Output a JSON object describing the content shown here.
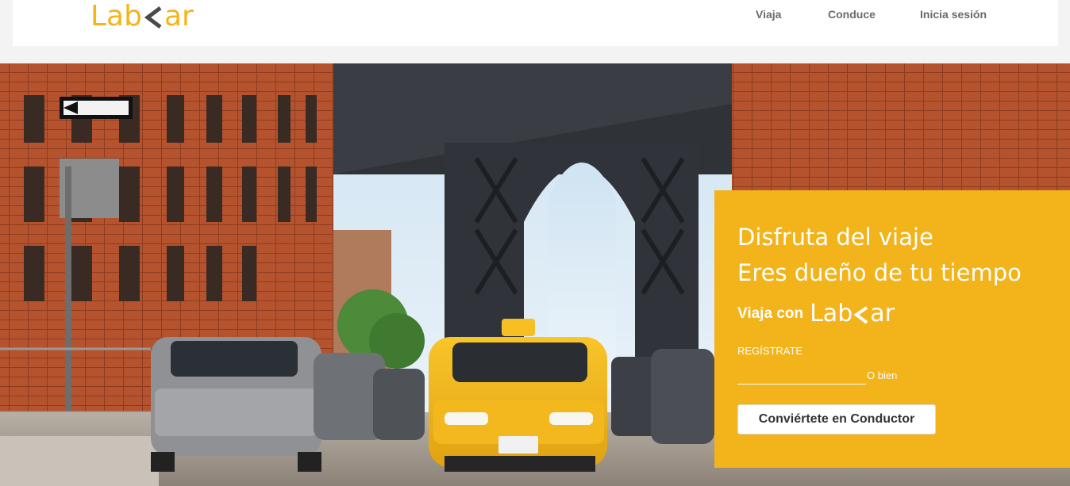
{
  "brand": {
    "name_left": "Lab",
    "name_right": "ar",
    "color": "#f4b51a"
  },
  "nav": {
    "items": [
      "Viaja",
      "Conduce",
      "Inicia sesión"
    ]
  },
  "hero": {
    "image": "city-street-taxi-bridge-photo"
  },
  "panel": {
    "background": "#f3b31b",
    "tagline_1": "Disfruta del viaje",
    "tagline_2": "Eres dueño de tu tiempo",
    "ride_with": "Viaja con",
    "register_label": "REGÍSTRATE",
    "email_placeholder": "",
    "or_label": "O bien",
    "driver_button": "Conviértete en Conductor"
  }
}
